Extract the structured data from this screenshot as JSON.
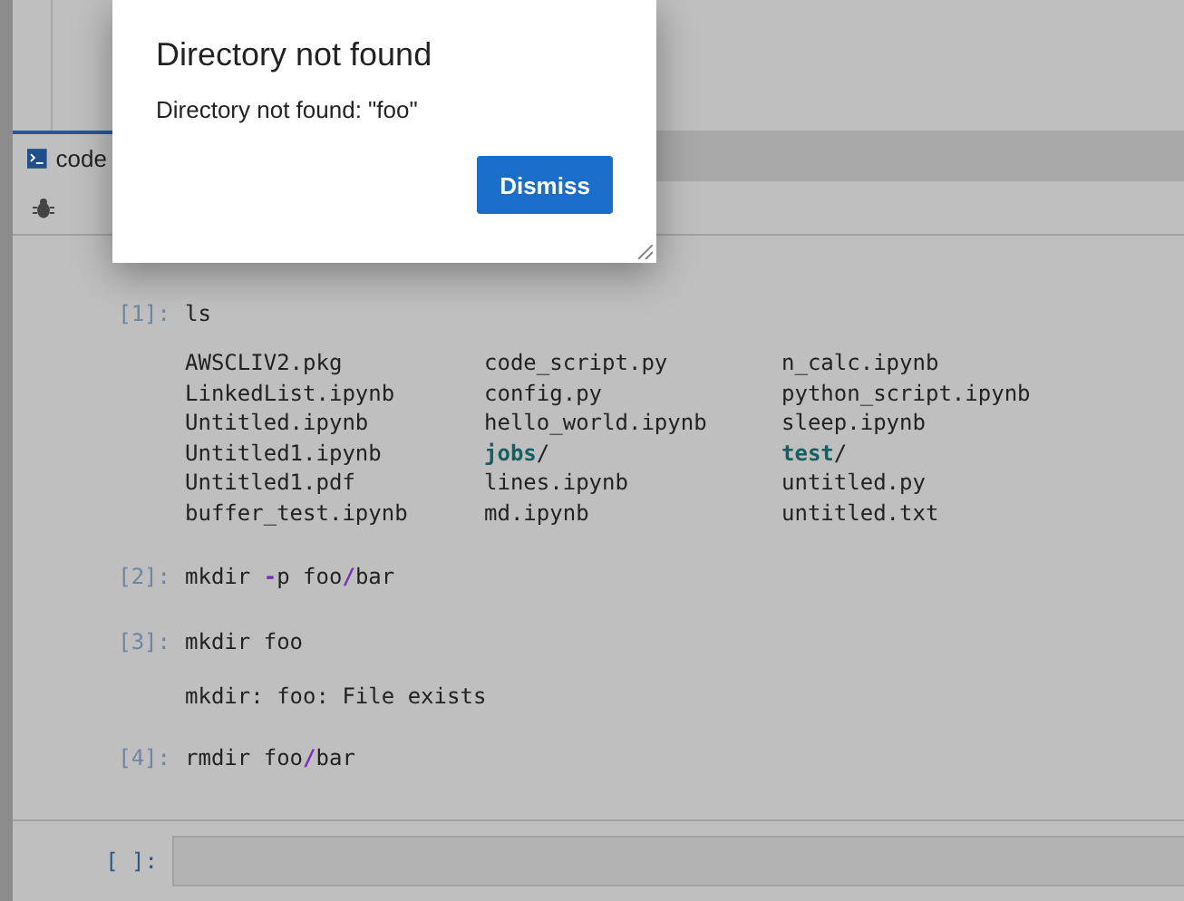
{
  "tab": {
    "label": "code"
  },
  "cells": [
    {
      "prompt": "[1]:",
      "code": [
        {
          "text": "ls",
          "kind": "plain"
        }
      ],
      "listing": [
        {
          "name": "AWSCLIV2.pkg",
          "kind": "file"
        },
        {
          "name": "code_script.py",
          "kind": "file"
        },
        {
          "name": "n_calc.ipynb",
          "kind": "file"
        },
        {
          "name": "LinkedList.ipynb",
          "kind": "file"
        },
        {
          "name": "config.py",
          "kind": "file"
        },
        {
          "name": "python_script.ipynb",
          "kind": "file"
        },
        {
          "name": "Untitled.ipynb",
          "kind": "file"
        },
        {
          "name": "hello_world.ipynb",
          "kind": "file"
        },
        {
          "name": "sleep.ipynb",
          "kind": "file"
        },
        {
          "name": "Untitled1.ipynb",
          "kind": "file"
        },
        {
          "name": "jobs",
          "suffix": "/",
          "kind": "directory"
        },
        {
          "name": "test",
          "suffix": "/",
          "kind": "directory"
        },
        {
          "name": "Untitled1.pdf",
          "kind": "file"
        },
        {
          "name": "lines.ipynb",
          "kind": "file"
        },
        {
          "name": "untitled.py",
          "kind": "file"
        },
        {
          "name": "buffer_test.ipynb",
          "kind": "file"
        },
        {
          "name": "md.ipynb",
          "kind": "file"
        },
        {
          "name": "untitled.txt",
          "kind": "file"
        }
      ]
    },
    {
      "prompt": "[2]:",
      "code": [
        {
          "text": "mkdir ",
          "kind": "plain"
        },
        {
          "text": "-",
          "kind": "operator"
        },
        {
          "text": "p foo",
          "kind": "plain"
        },
        {
          "text": "/",
          "kind": "operator"
        },
        {
          "text": "bar",
          "kind": "plain"
        }
      ]
    },
    {
      "prompt": "[3]:",
      "code": [
        {
          "text": "mkdir foo",
          "kind": "plain"
        }
      ],
      "output": "mkdir: foo: File exists"
    },
    {
      "prompt": "[4]:",
      "code": [
        {
          "text": "rmdir foo",
          "kind": "plain"
        },
        {
          "text": "/",
          "kind": "operator"
        },
        {
          "text": "bar",
          "kind": "plain"
        }
      ]
    }
  ],
  "new_cell": {
    "prompt": "[ ]:"
  },
  "dialog": {
    "title": "Directory not found",
    "message": "Directory not found: \"foo\"",
    "buttons": [
      "Dismiss"
    ]
  }
}
